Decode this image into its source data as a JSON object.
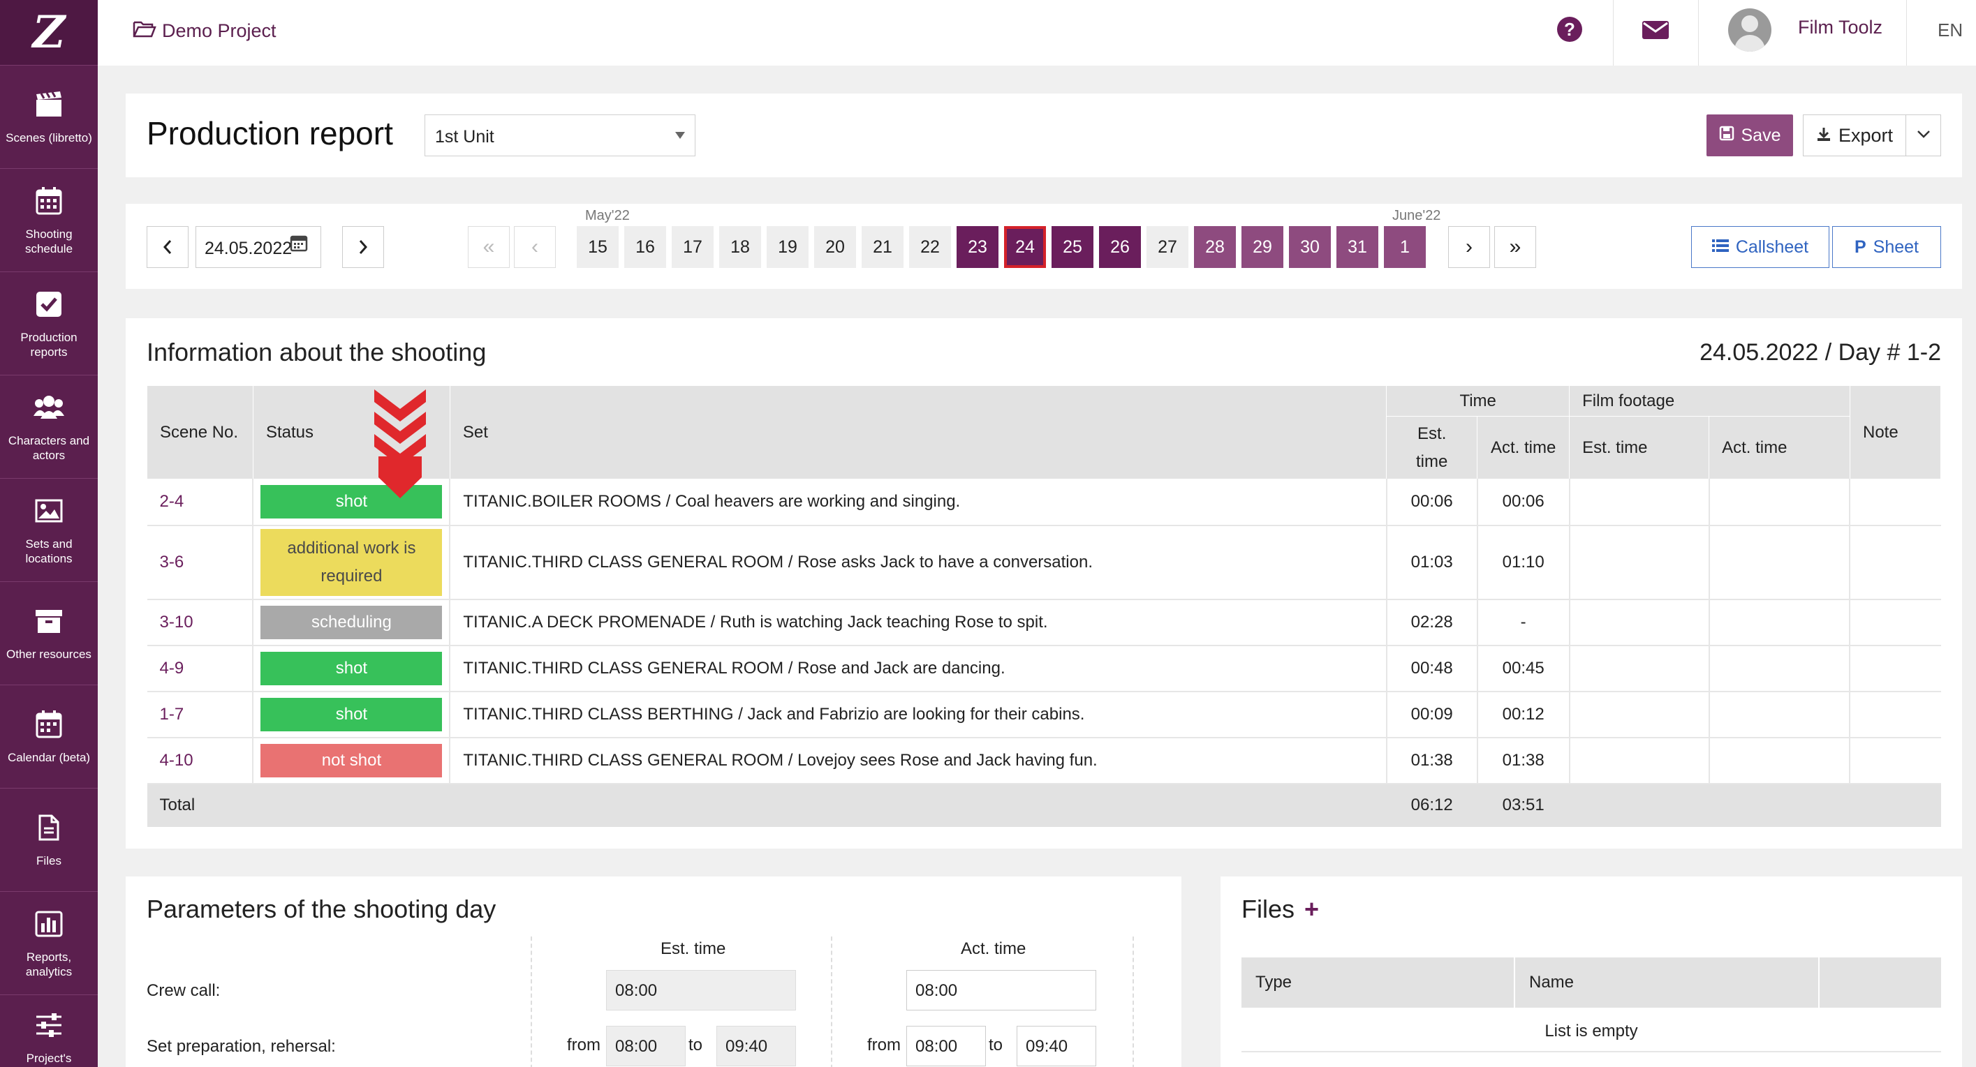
{
  "sidebar": {
    "logo": "Z",
    "items": [
      {
        "label": "Scenes (libretto)",
        "icon": "clapperboard-icon"
      },
      {
        "label": "Shooting schedule",
        "icon": "calendar-grid-icon"
      },
      {
        "label": "Production reports",
        "icon": "check-square-icon"
      },
      {
        "label": "Characters and actors",
        "icon": "users-icon"
      },
      {
        "label": "Sets and locations",
        "icon": "image-icon"
      },
      {
        "label": "Other resources",
        "icon": "archive-box-icon"
      },
      {
        "label": "Calendar (beta)",
        "icon": "calendar-icon"
      },
      {
        "label": "Files",
        "icon": "file-icon"
      },
      {
        "label": "Reports, analytics",
        "icon": "bar-chart-icon"
      },
      {
        "label": "Project's",
        "icon": "sliders-icon"
      }
    ]
  },
  "topbar": {
    "project": "Demo Project",
    "user": "Film Toolz",
    "lang": "EN"
  },
  "header": {
    "title": "Production report",
    "unit": "1st Unit",
    "save": "Save",
    "export": "Export"
  },
  "nav": {
    "date": "24.05.2022",
    "month1": "May'22",
    "month2": "June'22",
    "days": [
      "15",
      "16",
      "17",
      "18",
      "19",
      "20",
      "21",
      "22",
      "23",
      "24",
      "25",
      "26",
      "27",
      "28",
      "29",
      "30",
      "31",
      "1"
    ],
    "callsheet": "Callsheet",
    "sheet": "Sheet"
  },
  "info": {
    "title": "Information about the shooting",
    "day_label": "24.05.2022 / Day # 1-2",
    "headers": {
      "scene": "Scene No.",
      "status": "Status",
      "set": "Set",
      "time": "Time",
      "est": "Est. time",
      "act": "Act. time",
      "footage": "Film footage",
      "fest": "Est. time",
      "fact": "Act. time",
      "note": "Note"
    },
    "rows": [
      {
        "scene": "2-4",
        "status": "shot",
        "set": "TITANIC.BOILER ROOMS / Coal heavers are working and singing.",
        "est": "00:06",
        "act": "00:06"
      },
      {
        "scene": "3-6",
        "status": "additional work is required",
        "set": "TITANIC.THIRD CLASS GENERAL ROOM / Rose asks Jack to have a conversation.",
        "est": "01:03",
        "act": "01:10"
      },
      {
        "scene": "3-10",
        "status": "scheduling",
        "set": "TITANIC.A DECK PROMENADE / Ruth is watching Jack teaching Rose to spit.",
        "est": "02:28",
        "act": "-"
      },
      {
        "scene": "4-9",
        "status": "shot",
        "set": "TITANIC.THIRD CLASS GENERAL ROOM / Rose and Jack are dancing.",
        "est": "00:48",
        "act": "00:45"
      },
      {
        "scene": "1-7",
        "status": "shot",
        "set": "TITANIC.THIRD CLASS BERTHING / Jack and Fabrizio are looking for their cabins.",
        "est": "00:09",
        "act": "00:12"
      },
      {
        "scene": "4-10",
        "status": "not shot",
        "set": "TITANIC.THIRD CLASS GENERAL ROOM / Lovejoy sees Rose and Jack having fun.",
        "est": "01:38",
        "act": "01:38"
      }
    ],
    "total_label": "Total",
    "total_est": "06:12",
    "total_act": "03:51"
  },
  "params": {
    "title": "Parameters of the shooting day",
    "est_header": "Est. time",
    "act_header": "Act. time",
    "crew_call": "Crew call:",
    "crew_est": "08:00",
    "crew_act": "08:00",
    "set_prep": "Set preparation, rehersal:",
    "from": "from",
    "to": "to",
    "prep_est_from": "08:00",
    "prep_est_to": "09:40",
    "prep_act_from": "08:00",
    "prep_act_to": "09:40"
  },
  "files": {
    "title": "Files",
    "col_type": "Type",
    "col_name": "Name",
    "empty": "List is empty"
  },
  "colors": {
    "brand": "#5b1f4e",
    "accent": "#6a1e5c",
    "shot": "#37c15a",
    "additional": "#ecdb5c",
    "scheduling": "#a9a9a9",
    "not_shot": "#e97272"
  }
}
